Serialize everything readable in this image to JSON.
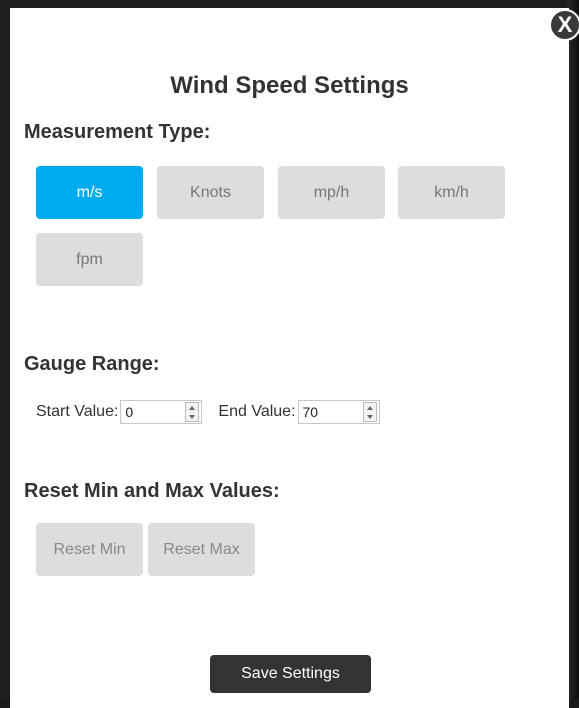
{
  "dialog": {
    "title": "Wind Speed Settings",
    "close_label": "X"
  },
  "measurement": {
    "heading": "Measurement Type:",
    "selected": "m/s",
    "options": [
      "m/s",
      "Knots",
      "mp/h",
      "km/h",
      "fpm"
    ]
  },
  "gauge_range": {
    "heading": "Gauge Range:",
    "start_label": "Start Value:",
    "start_value": "0",
    "end_label": "End Value:",
    "end_value": "70"
  },
  "reset": {
    "heading": "Reset Min and Max Values:",
    "min_label": "Reset Min",
    "max_label": "Reset Max"
  },
  "save_label": "Save Settings",
  "colors": {
    "accent": "#00aaee",
    "button_bg": "#dddddd",
    "save_bg": "#333333"
  }
}
